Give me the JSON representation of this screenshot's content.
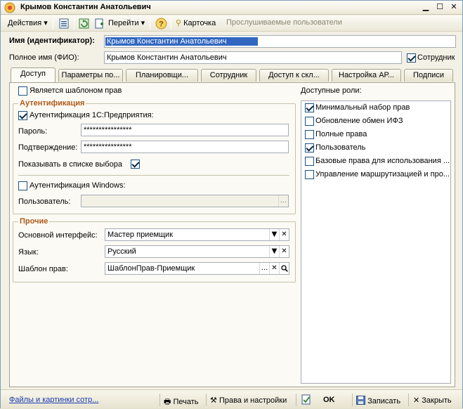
{
  "window": {
    "title": "Крымов Константин Анатольевич",
    "controls": [
      "minimize",
      "maximize",
      "close"
    ]
  },
  "toolbar": {
    "actions_label": "Действия",
    "goto_label": "Перейти",
    "help_label": "?",
    "card_label": "Карточка",
    "monitored_users_label": "Прослушиваемые пользователи"
  },
  "header": {
    "name_label": "Имя (идентификатор):",
    "name_value": "Крымов Константин Анатольевич",
    "fullname_label": "Полное имя (ФИО):",
    "fullname_value": "Крымов Константин Анатольевич",
    "employee_label": "Сотрудник",
    "employee_checked": true
  },
  "tabs": [
    {
      "label": "Доступ",
      "active": true
    },
    {
      "label": "Параметры по..."
    },
    {
      "label": "Планировщи..."
    },
    {
      "label": "Сотрудник"
    },
    {
      "label": "Доступ к скл..."
    },
    {
      "label": "Настройка АР..."
    },
    {
      "label": "Подписи"
    }
  ],
  "access": {
    "is_template_label": "Является шаблоном прав",
    "is_template_checked": false,
    "auth_group_title": "Аутентификация",
    "auth_1c_label": "Аутентификация 1С:Предприятия:",
    "auth_1c_checked": true,
    "password_label": "Пароль:",
    "password_value": "****************",
    "confirm_label": "Подтверждение:",
    "confirm_value": "****************",
    "show_in_list_label": "Показывать в списке выбора",
    "show_in_list_checked": true,
    "auth_windows_label": "Аутентификация Windows:",
    "auth_windows_checked": false,
    "user_label": "Пользователь:",
    "user_value": "",
    "user_button": "...",
    "other_group_title": "Прочие",
    "interface_label": "Основной интерфейс:",
    "interface_value": "Мастер приемщик",
    "language_label": "Язык:",
    "language_value": "Русский",
    "template_label": "Шаблон прав:",
    "template_value": "ШаблонПрав-Приемщик",
    "template_button": "..."
  },
  "roles": {
    "label": "Доступные роли:",
    "items": [
      {
        "label": "Минимальный набор прав",
        "checked": true
      },
      {
        "label": "Обновление обмен ИФЗ",
        "checked": false
      },
      {
        "label": "Полные права",
        "checked": false
      },
      {
        "label": "Пользователь",
        "checked": true
      },
      {
        "label": "Базовые права для использования ...",
        "checked": false
      },
      {
        "label": "Управление маршрутизацией и про...",
        "checked": false
      }
    ]
  },
  "statusbar": {
    "files_link": "Файлы и картинки сотр...",
    "print_label": "Печать",
    "rights_label": "Права и настройки",
    "ok_label": "OK",
    "save_label": "Записать",
    "close_label": "Закрыть"
  },
  "colors": {
    "group_title": "#b05a19",
    "selection": "#3167c0",
    "link": "#1a3cb4"
  }
}
